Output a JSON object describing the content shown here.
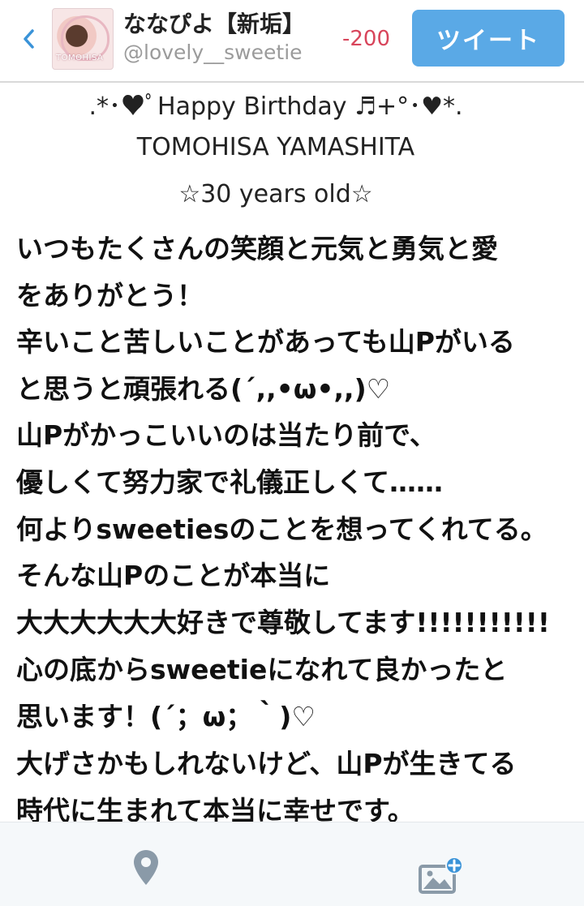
{
  "header": {
    "user_name": "ななぴよ【新垢】",
    "user_handle": "@lovely__sweetie",
    "char_count": "-200",
    "tweet_label": "ツイート",
    "avatar_text": "TOMOHISA"
  },
  "tweet": {
    "title_lines": [
      ".*･♥ﾟHappy Birthday ♬+°･♥*.",
      "TOMOHISA YAMASHITA",
      "☆30 years old☆"
    ],
    "body_lines": [
      "いつもたくさんの笑顔と元気と勇気と愛",
      "をありがとう！",
      "辛いこと苦しいことがあっても山Pがいる",
      "と思うと頑張れる(´,,•ω•,,)♡",
      "山Pがかっこいいのは当たり前で、",
      "優しくて努力家で礼儀正しくて……",
      "何よりsweetiesのことを想ってくれてる。",
      "そんな山Pのことが本当に",
      "大大大大大大好きで尊敬してます!!!!!!!!!!!",
      "心の底からsweetieになれて良かったと",
      "思います！(´；ω；｀)♡",
      "大げさかもしれないけど、山Pが生きてる",
      "時代に生まれて本当に幸せです。"
    ]
  },
  "colors": {
    "tweet_button": "#5aa9e6",
    "count_negative": "#d8455b",
    "icon_gray": "#8a9aa8",
    "accent_blue": "#3a93d8"
  },
  "icons": {
    "back": "chevron-left-icon",
    "location": "location-pin-icon",
    "media": "add-photo-icon"
  }
}
